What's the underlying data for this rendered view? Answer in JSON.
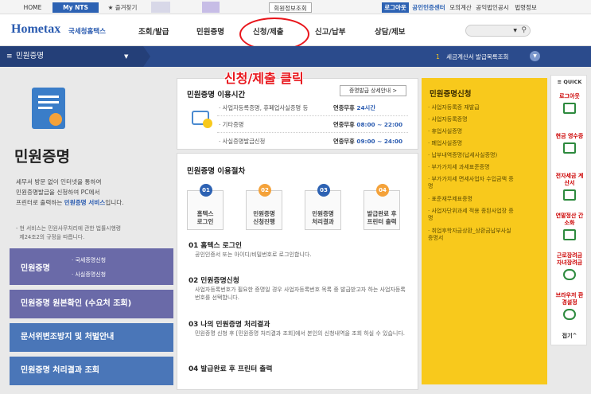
{
  "topbar": {
    "home": "HOME",
    "mynts": "My NTS",
    "favorites": "★ 즐겨찾기",
    "member_search": "회원정보조회",
    "logout": "로그아웃",
    "cert_center": "공인인증센터",
    "mock_calc": "모의계산",
    "notice_search": "공익법인공시",
    "law_info": "법령정보"
  },
  "header": {
    "logo_text": "Hometax",
    "logo_sub": "국세청홈택스",
    "gnb": [
      "조회/발급",
      "민원증명",
      "신청/제출",
      "신고/납부",
      "상담/제보"
    ]
  },
  "pathbar": {
    "current": "민원증명",
    "right_text": "세금계산서 발급목록조회"
  },
  "annotation": {
    "text": "신청/제출 클릭",
    "color": "#e8151b"
  },
  "left": {
    "title": "민원증명",
    "desc_lines": [
      "세무서 방문 없이 인터넷을 통하여",
      "민원증명발급을 신청하여 PC에서",
      "프린터로 출력하는 민원증명 서비스입니다."
    ],
    "desc_highlight": "민원증명 서비스",
    "note_lines": [
      "- 현 서비스는 민원사무처리에 관한 법률시행령",
      "  제24조2의 규정을 따릅니다."
    ],
    "nav": [
      {
        "label": "민원증명",
        "subs": [
          "국세증명신청",
          "사실증명신청"
        ]
      },
      {
        "label": "민원증명 원본확인 (수요처 조회)"
      },
      {
        "label": "문서위변조방지 및 처벌안내"
      },
      {
        "label": "민원증명 처리결과 조회"
      }
    ]
  },
  "hours": {
    "title": "민원증명 이용시간",
    "detail_button": "증명발급 상세안내 >",
    "rows": [
      {
        "label": "사업자등록증명, 휴폐업사실증명 등",
        "day": "연중무휴",
        "time": "24시간"
      },
      {
        "label": "기타증명",
        "day": "연중무휴",
        "time": "08:00 ~ 22:00"
      },
      {
        "label": "사실증명발급신청",
        "day": "연중무휴",
        "time": "09:00 ~ 24:00"
      }
    ]
  },
  "procedure": {
    "title": "민원증명 이용절차",
    "steps": [
      {
        "num": "01",
        "label1": "홈텍스",
        "label2": "로그인"
      },
      {
        "num": "02",
        "label1": "민원증명",
        "label2": "신청진행"
      },
      {
        "num": "03",
        "label1": "민원증명",
        "label2": "처리결과"
      },
      {
        "num": "04",
        "label1": "발급완료 후",
        "label2": "프린터 출력"
      }
    ],
    "sections": [
      {
        "head": "01 홈텍스 로그인",
        "text": "공인인증서 또는 아이디/비밀번호로 로그인합니다."
      },
      {
        "head": "02 민원증명신청",
        "text": "사업자등록번호가 필요한 증명일 경우 사업자등록번호 목록 중 발급받고자 하는 사업자등록번호를 선택합니다."
      },
      {
        "head": "03 나의 민원증명 처리결과",
        "text": "민원증명 신청 후 [민원증명 처리결과 조회]에서 본인의 신청내역을 조회 하실 수 있습니다."
      },
      {
        "head": "04 발급완료 후 프린터 출력",
        "text": ""
      }
    ]
  },
  "apply": {
    "title": "민원증명신청",
    "items": [
      "사업자등록증 재발급",
      "사업자등록증명",
      "휴업사실증명",
      "폐업사실증명",
      "납부내역증명(납세사실증명)",
      "부가가치세 과세표준증명",
      "부가가치세 면세사업자 수입금액 증명",
      "표준재무제표증명",
      "사업자단위과세 적용 종된사업장 증명",
      "취업후학자금상환_상환금납부사실증명서"
    ]
  },
  "quick": {
    "title": "QUICK",
    "items": [
      "로그아웃",
      "현금 영수증",
      "전자세금 계산서",
      "연말정산 간소화",
      "근로장려금 자녀장려금",
      "브라우저 환경설정"
    ],
    "close": "접기^"
  },
  "colors": {
    "navy": "#2b4b8c",
    "nav_purple": "#6a6aa8",
    "nav_blue": "#4a76b8",
    "yellow": "#f8c91c"
  }
}
